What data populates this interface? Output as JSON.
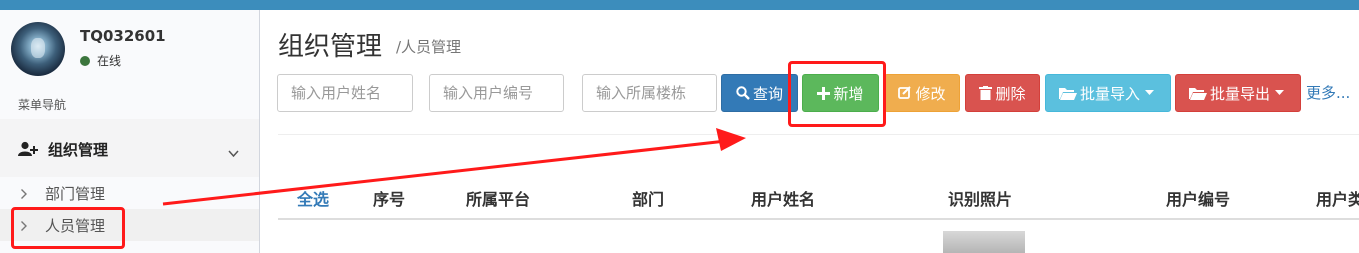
{
  "user": {
    "name": "TQ032601",
    "status": "在线"
  },
  "sidebar": {
    "nav_header": "菜单导航",
    "menu": {
      "label": "组织管理"
    },
    "items": [
      {
        "label": "部门管理"
      },
      {
        "label": "人员管理"
      }
    ]
  },
  "page": {
    "title": "组织管理",
    "breadcrumb": "/人员管理"
  },
  "search": {
    "name_placeholder": "输入用户姓名",
    "code_placeholder": "输入用户编号",
    "building_placeholder": "输入所属楼栋"
  },
  "toolbar": {
    "query": "查询",
    "add": "新增",
    "edit": "修改",
    "delete": "删除",
    "import": "批量导入",
    "export": "批量导出",
    "more": "更多..."
  },
  "table": {
    "columns": [
      "全选",
      "序号",
      "所属平台",
      "部门",
      "用户姓名",
      "识别照片",
      "用户编号",
      "用户类"
    ]
  },
  "colors": {
    "query": "#337ab7",
    "add": "#5cb85c",
    "edit": "#f0ad4e",
    "delete": "#d9534f",
    "import": "#5bc0de",
    "export": "#d9534f",
    "highlight": "#ff1a1a"
  }
}
